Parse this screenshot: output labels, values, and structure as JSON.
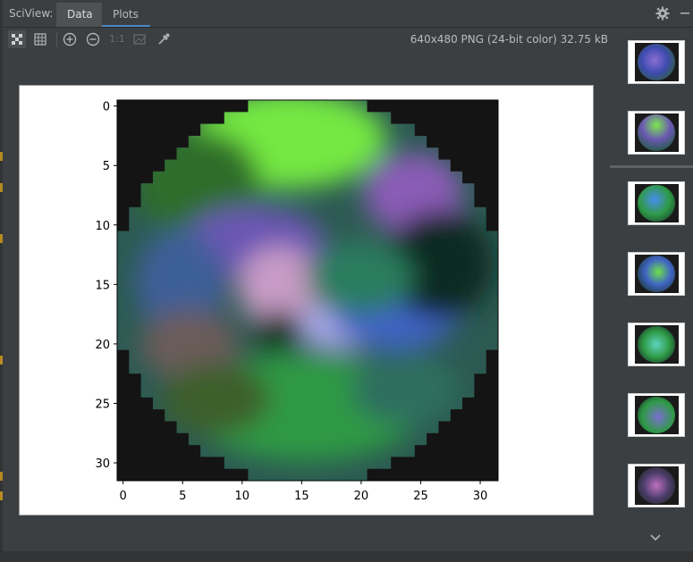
{
  "window": {
    "title": "SciView:",
    "tabs": [
      {
        "label": "Data",
        "active": false
      },
      {
        "label": "Plots",
        "active": true
      }
    ]
  },
  "toolbar": {
    "zoom_actual_label": "1:1",
    "icons": [
      "fit-grid-icon",
      "grid-icon",
      "zoom-in-icon",
      "zoom-out-icon",
      "actual-size-icon",
      "background-icon",
      "color-picker-icon"
    ]
  },
  "image_info": "640x480 PNG (24-bit color) 32.75 kB",
  "thumbnails": [
    "plot-1",
    "plot-2",
    "plot-3",
    "plot-4",
    "plot-5",
    "plot-6",
    "plot-7"
  ],
  "chart_data": {
    "type": "heatmap",
    "title": "",
    "xlabel": "",
    "ylabel": "",
    "x_ticks": [
      "0",
      "5",
      "10",
      "15",
      "20",
      "25",
      "30"
    ],
    "y_ticks": [
      "0",
      "5",
      "10",
      "15",
      "20",
      "25",
      "30"
    ],
    "xlim": [
      -0.5,
      31.5
    ],
    "ylim": [
      31.5,
      -0.5
    ],
    "grid": false,
    "size": [
      32,
      32
    ],
    "description_colors": {
      "background": "#141414",
      "green": "#74e843",
      "purple": "#8a5bb6",
      "blue": "#4164c3",
      "teal": "#2b7d5f"
    }
  },
  "colors": {
    "panel_bg": "#3c3f41",
    "accent": "#4a88c7"
  }
}
